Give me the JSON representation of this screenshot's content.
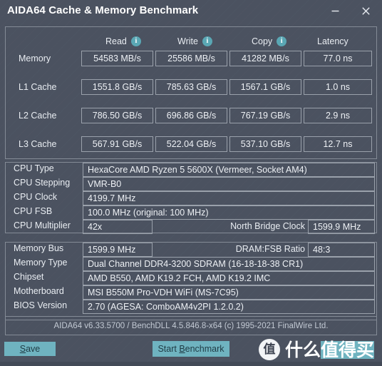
{
  "window": {
    "title": "AIDA64 Cache & Memory Benchmark",
    "minimize_label": "minimize",
    "close_label": "close"
  },
  "benchmark": {
    "columns": [
      {
        "label": "Read",
        "has_info": true
      },
      {
        "label": "Write",
        "has_info": true
      },
      {
        "label": "Copy",
        "has_info": true
      },
      {
        "label": "Latency",
        "has_info": false
      }
    ],
    "rows": [
      {
        "label": "Memory",
        "read": "54583 MB/s",
        "write": "25586 MB/s",
        "copy": "41282 MB/s",
        "latency": "77.0 ns"
      },
      {
        "label": "L1 Cache",
        "read": "1551.8 GB/s",
        "write": "785.63 GB/s",
        "copy": "1567.1 GB/s",
        "latency": "1.0 ns"
      },
      {
        "label": "L2 Cache",
        "read": "786.50 GB/s",
        "write": "696.86 GB/s",
        "copy": "767.19 GB/s",
        "latency": "2.9 ns"
      },
      {
        "label": "L3 Cache",
        "read": "567.91 GB/s",
        "write": "522.04 GB/s",
        "copy": "537.10 GB/s",
        "latency": "12.7 ns"
      }
    ]
  },
  "cpu_info": {
    "cpu_type_label": "CPU Type",
    "cpu_type_value": "HexaCore AMD Ryzen 5 5600X  (Vermeer, Socket AM4)",
    "cpu_stepping_label": "CPU Stepping",
    "cpu_stepping_value": "VMR-B0",
    "cpu_clock_label": "CPU Clock",
    "cpu_clock_value": "4199.7 MHz",
    "cpu_fsb_label": "CPU FSB",
    "cpu_fsb_value": "100.0 MHz  (original: 100 MHz)",
    "cpu_multiplier_label": "CPU Multiplier",
    "cpu_multiplier_value": "42x",
    "north_bridge_label": "North Bridge Clock",
    "north_bridge_value": "1599.9 MHz"
  },
  "memory_info": {
    "memory_bus_label": "Memory Bus",
    "memory_bus_value": "1599.9 MHz",
    "dram_fsb_label": "DRAM:FSB Ratio",
    "dram_fsb_value": "48:3",
    "memory_type_label": "Memory Type",
    "memory_type_value": "Dual Channel DDR4-3200 SDRAM  (16-18-18-38 CR1)",
    "chipset_label": "Chipset",
    "chipset_value": "AMD B550, AMD K19.2 FCH, AMD K19.2 IMC",
    "motherboard_label": "Motherboard",
    "motherboard_value": "MSI B550M Pro-VDH WiFi (MS-7C95)",
    "bios_label": "BIOS Version",
    "bios_value": "2.70  (AGESA: ComboAM4v2PI 1.2.0.2)"
  },
  "status": {
    "version_line": "AIDA64 v6.33.5700 / BenchDLL 4.5.846.8-x64  (c) 1995-2021 FinalWire Ltd."
  },
  "buttons": {
    "save_prefix": "",
    "save_accel": "S",
    "save_suffix": "ave",
    "start_prefix": "Start ",
    "start_accel": "B",
    "start_suffix": "enchmark"
  },
  "watermark": {
    "logo_glyph": "值",
    "text_plain": "什么",
    "text_highlight": "值得买"
  },
  "colors": {
    "window_bg": "#4b5260",
    "accent": "#6fb3c0",
    "info_icon": "#5aa7b4",
    "border": "#9aa1ab",
    "panel_border": "#848b96",
    "text": "#e9edf2",
    "status_text": "#c3cad4"
  }
}
